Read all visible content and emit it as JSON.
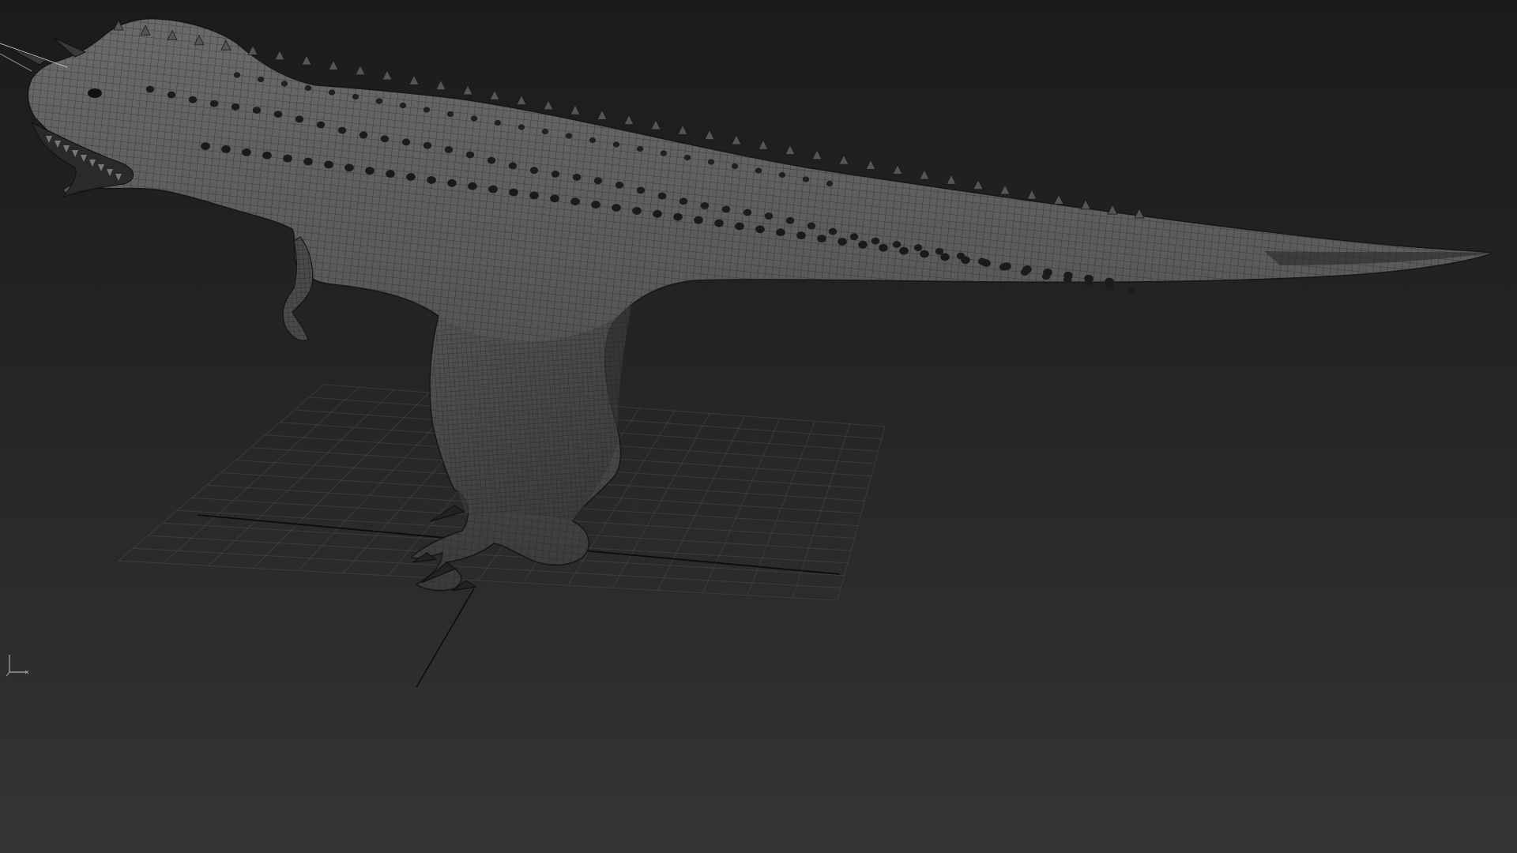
{
  "viewport": {
    "type": "3d-perspective-viewport",
    "background_top": "#1b1b1b",
    "background_bottom": "#353535"
  },
  "model": {
    "subject": "dinosaur",
    "display_mode": "wireframe-on-shaded",
    "mesh_color": "#5a5a5a",
    "wire_color": "#1e1e1e"
  },
  "grid": {
    "visible": true,
    "color": "#4a4a4a",
    "axis_color": "#0c0c0c"
  },
  "gizmo": {
    "icon": "axis-tripod-icon",
    "color": "#9a9a9a"
  }
}
